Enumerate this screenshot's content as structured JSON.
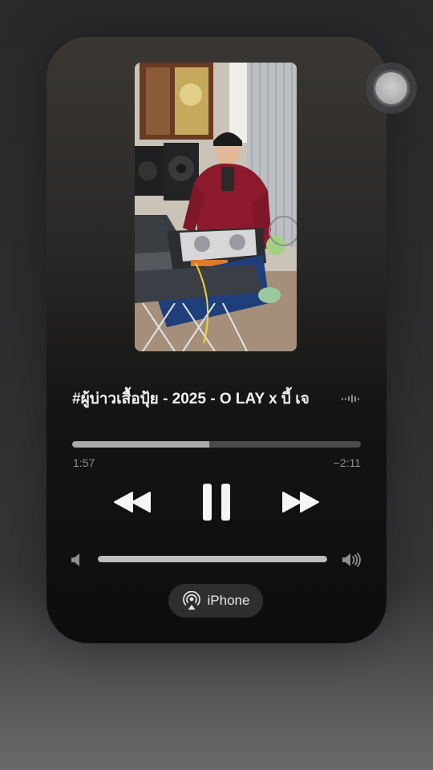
{
  "now_playing": {
    "title": "#ผู้บ่าวเสื้อปุ้ย - 2025 - O LAY x บี้ เจ",
    "artwork_icon": "dj-at-turntable-photo",
    "elapsed": "1:57",
    "remaining": "−2:11",
    "progress": 0.475
  },
  "controls": {
    "rewind_icon": "rewind-icon",
    "pause_icon": "pause-icon",
    "forward_icon": "fast-forward-icon"
  },
  "volume": {
    "level": 1.0,
    "low_icon": "speaker-low-icon",
    "high_icon": "speaker-high-icon"
  },
  "output": {
    "label": "iPhone",
    "icon": "airplay-icon"
  },
  "overlay": {
    "assistive_touch_icon": "assistive-touch-icon"
  },
  "colors": {
    "track_fill": "#a9a9a9",
    "track_bg": "#4a4a4a",
    "text_primary": "#f2f2f2",
    "text_secondary": "#8d8d8d"
  }
}
